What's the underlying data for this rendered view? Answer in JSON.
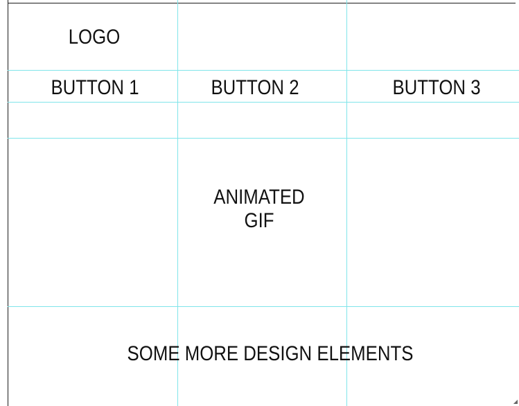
{
  "mockup": {
    "logo_label": "LOGO",
    "nav": {
      "button_1": "BUTTON 1",
      "button_2": "BUTTON 2",
      "button_3": "BUTTON 3"
    },
    "hero": {
      "line_1": "ANIMATED",
      "line_2": "GIF"
    },
    "footer_text": "SOME MORE DESIGN ELEMENTS"
  },
  "colors": {
    "guide_line": "#7fe5ea",
    "border": "#1a1a1a",
    "text": "#111111",
    "background": "#ffffff"
  }
}
